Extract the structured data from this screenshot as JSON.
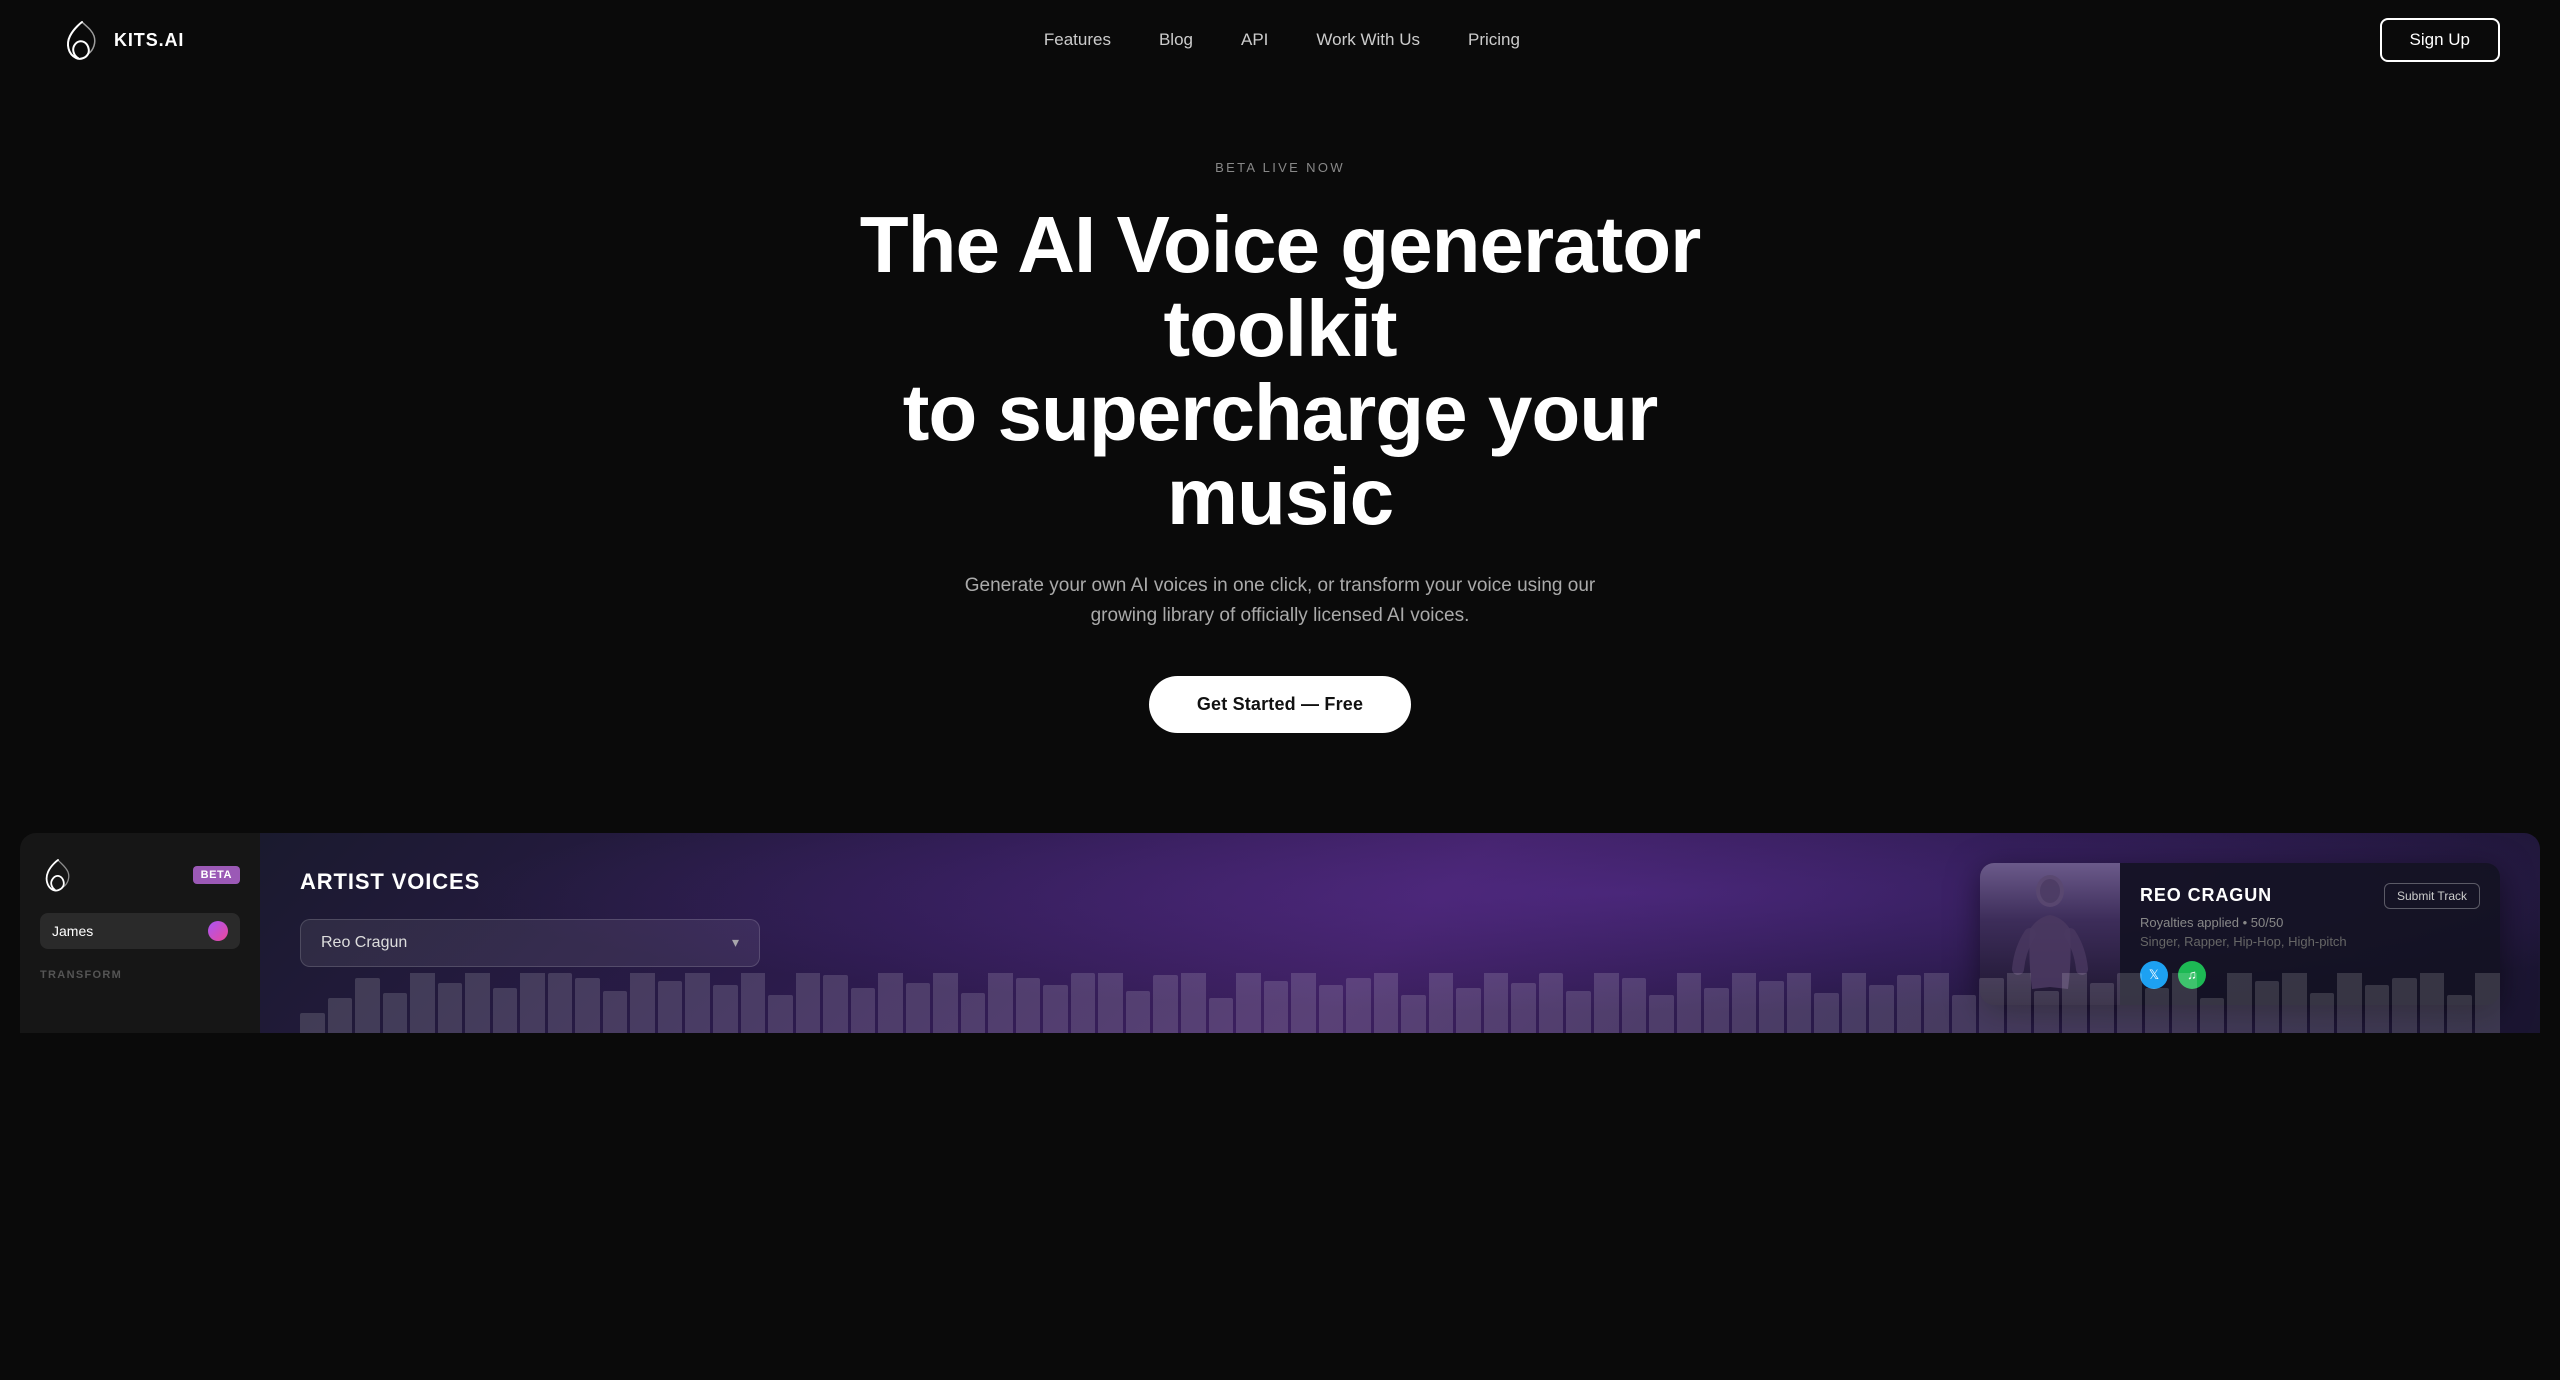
{
  "brand": {
    "name": "KITS.AI",
    "logo_alt": "Kits AI Logo"
  },
  "nav": {
    "links": [
      {
        "id": "features",
        "label": "Features"
      },
      {
        "id": "blog",
        "label": "Blog"
      },
      {
        "id": "api",
        "label": "API"
      },
      {
        "id": "work-with-us",
        "label": "Work With Us"
      },
      {
        "id": "pricing",
        "label": "Pricing"
      }
    ],
    "signup_label": "Sign Up"
  },
  "hero": {
    "badge": "BETA LIVE NOW",
    "title_line1": "The AI Voice generator toolkit",
    "title_line2": "to supercharge your music",
    "subtitle": "Generate your own AI voices in one click, or transform your voice using our growing library of officially licensed AI voices.",
    "cta_label": "Get Started — Free"
  },
  "demo": {
    "beta_badge": "BETA",
    "user_name": "James",
    "transform_label": "TRANSFORM",
    "artist_voices_title": "ARTIST VOICES",
    "selected_artist": "Reo Cragun",
    "dropdown_placeholder": "Reo Cragun",
    "artist_card": {
      "name": "REO CRAGUN",
      "submit_label": "Submit Track",
      "royalties": "Royalties applied • 50/50",
      "genres": "Singer, Rapper, Hip-Hop, High-pitch"
    }
  },
  "waveform_heights": [
    20,
    35,
    55,
    40,
    65,
    50,
    70,
    45,
    80,
    60,
    55,
    42,
    68,
    52,
    75,
    48,
    62,
    38,
    72,
    58,
    45,
    82,
    50,
    65,
    40,
    70,
    55,
    48,
    60,
    75,
    42,
    58,
    68,
    35,
    78,
    52,
    62,
    48,
    55,
    70,
    38,
    65,
    45,
    80,
    50,
    60,
    42,
    72,
    55,
    38,
    68,
    45,
    75,
    52,
    62,
    40,
    70,
    48,
    58,
    82,
    38,
    55,
    65,
    42,
    78,
    50,
    60,
    45,
    72,
    35,
    68,
    52,
    62,
    40,
    80,
    48,
    55,
    65,
    38,
    75
  ]
}
